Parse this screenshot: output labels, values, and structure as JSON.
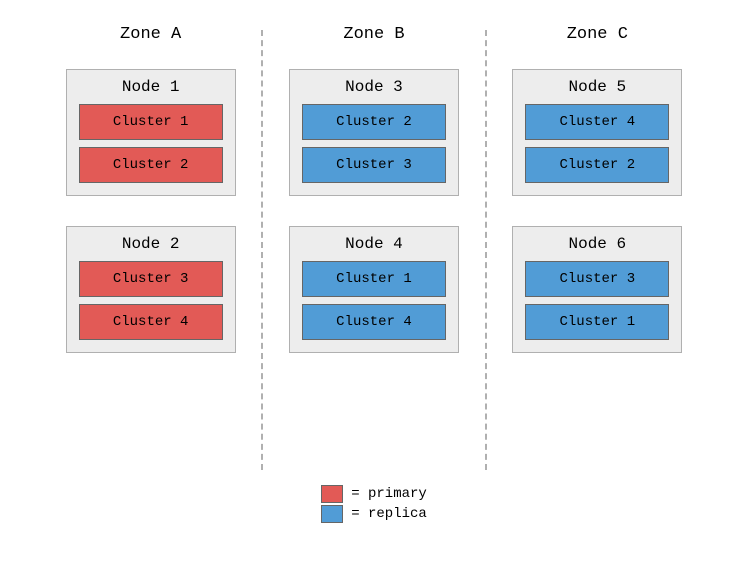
{
  "colors": {
    "primary": "#e25a56",
    "replica": "#519cd6"
  },
  "zones": [
    {
      "title": "Zone A",
      "nodes": [
        {
          "title": "Node 1",
          "clusters": [
            {
              "label": "Cluster 1",
              "type": "primary"
            },
            {
              "label": "Cluster 2",
              "type": "primary"
            }
          ]
        },
        {
          "title": "Node 2",
          "clusters": [
            {
              "label": "Cluster 3",
              "type": "primary"
            },
            {
              "label": "Cluster 4",
              "type": "primary"
            }
          ]
        }
      ]
    },
    {
      "title": "Zone B",
      "nodes": [
        {
          "title": "Node 3",
          "clusters": [
            {
              "label": "Cluster 2",
              "type": "replica"
            },
            {
              "label": "Cluster 3",
              "type": "replica"
            }
          ]
        },
        {
          "title": "Node 4",
          "clusters": [
            {
              "label": "Cluster 1",
              "type": "replica"
            },
            {
              "label": "Cluster 4",
              "type": "replica"
            }
          ]
        }
      ]
    },
    {
      "title": "Zone C",
      "nodes": [
        {
          "title": "Node 5",
          "clusters": [
            {
              "label": "Cluster 4",
              "type": "replica"
            },
            {
              "label": "Cluster 2",
              "type": "replica"
            }
          ]
        },
        {
          "title": "Node 6",
          "clusters": [
            {
              "label": "Cluster 3",
              "type": "replica"
            },
            {
              "label": "Cluster 1",
              "type": "replica"
            }
          ]
        }
      ]
    }
  ],
  "legend": {
    "primary": "= primary",
    "replica": "= replica"
  }
}
